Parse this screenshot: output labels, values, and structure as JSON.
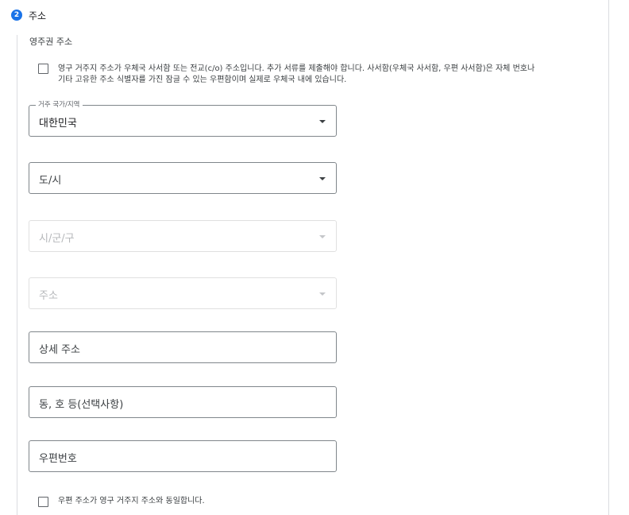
{
  "step": {
    "number": "2",
    "title": "주소"
  },
  "section": {
    "label": "영주권 주소"
  },
  "po_box_checkbox": {
    "line1": "영구 거주지 주소가 우체국 사서함 또는 전교(c/o) 주소입니다. 추가 서류를 제출해야 합니다. 사서함(우체국 사서함, 우편 사서함)은 자체 번호나",
    "line2": "기타 고유한 주소 식별자를 가진 잠글 수 있는 우편함이며 실제로 우체국 내에 있습니다.",
    "checked": false
  },
  "country_field": {
    "label": "거주 국가/지역",
    "value": "대한민국"
  },
  "province_field": {
    "placeholder": "도/시"
  },
  "city_field": {
    "placeholder": "시/군/구",
    "disabled": true
  },
  "address_select": {
    "placeholder": "주소",
    "disabled": true
  },
  "detail_address_field": {
    "placeholder": "상세 주소"
  },
  "unit_field": {
    "placeholder": "동, 호 등(선택사항)"
  },
  "postal_code_field": {
    "placeholder": "우편번호"
  },
  "same_address_checkbox": {
    "label": "우편 주소가 영구 거주지 주소와 동일합니다.",
    "checked": false
  },
  "colors": {
    "accent": "#1a73e8",
    "border": "#80868b",
    "disabled_border": "#e0e0e0"
  }
}
